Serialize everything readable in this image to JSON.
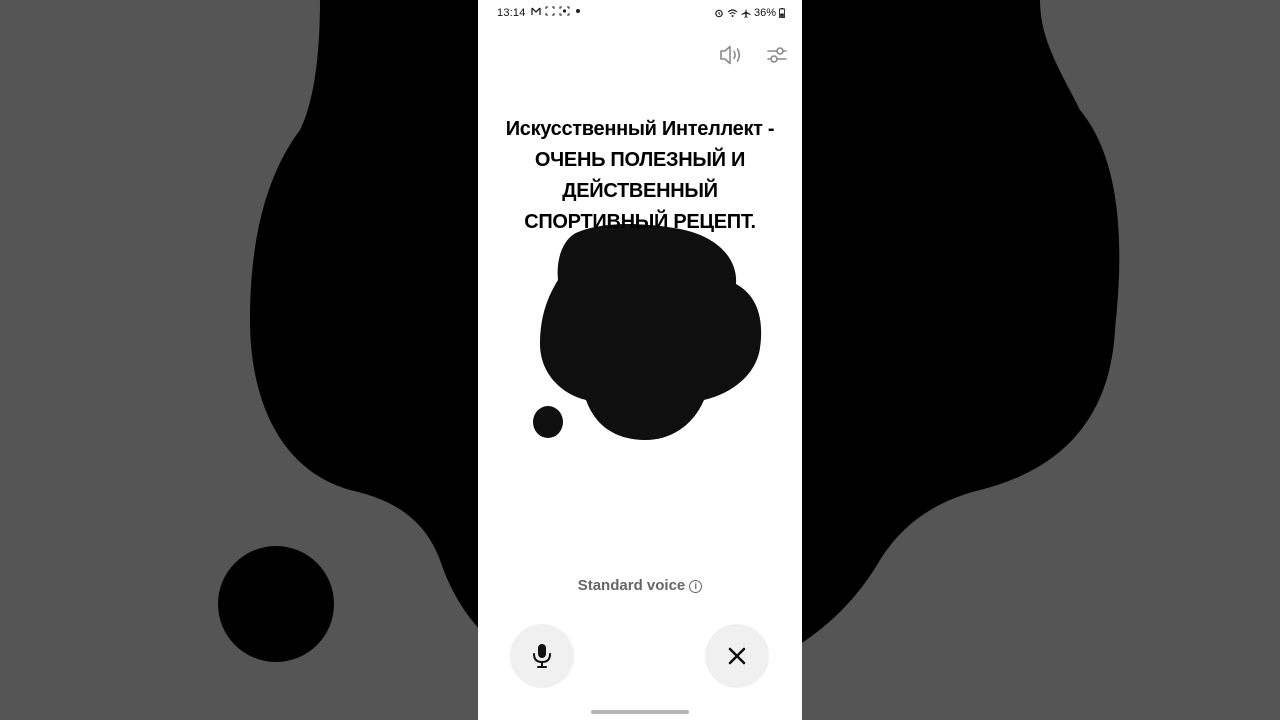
{
  "status_bar": {
    "time": "13:14",
    "battery": "36%",
    "left_icons": [
      "gmail-icon",
      "screen-capture-icon",
      "screen-record-icon",
      "dot-icon"
    ],
    "right_icons": [
      "alarm-icon",
      "wifi-icon",
      "airplane-icon",
      "battery-icon"
    ]
  },
  "top_actions": {
    "icons": [
      "speaker-icon",
      "settings-sliders-icon"
    ]
  },
  "headline": {
    "line1": "Искусственный Интеллект -",
    "line2": "ОЧЕНЬ ПОЛЕЗНЫЙ И",
    "line3": "ДЕЙСТВЕННЫЙ",
    "line4": "СПОРТИВНЫЙ РЕЦЕПТ."
  },
  "voice": {
    "label": "Standard voice",
    "info": "i"
  },
  "controls": {
    "mic_icon": "microphone-icon",
    "close_icon": "close-icon"
  },
  "colors": {
    "background": "#ffffff",
    "side_background": "#555555",
    "blob": "#0f0f0f",
    "button_bg": "#f0f0f0",
    "secondary_text": "#666666"
  }
}
